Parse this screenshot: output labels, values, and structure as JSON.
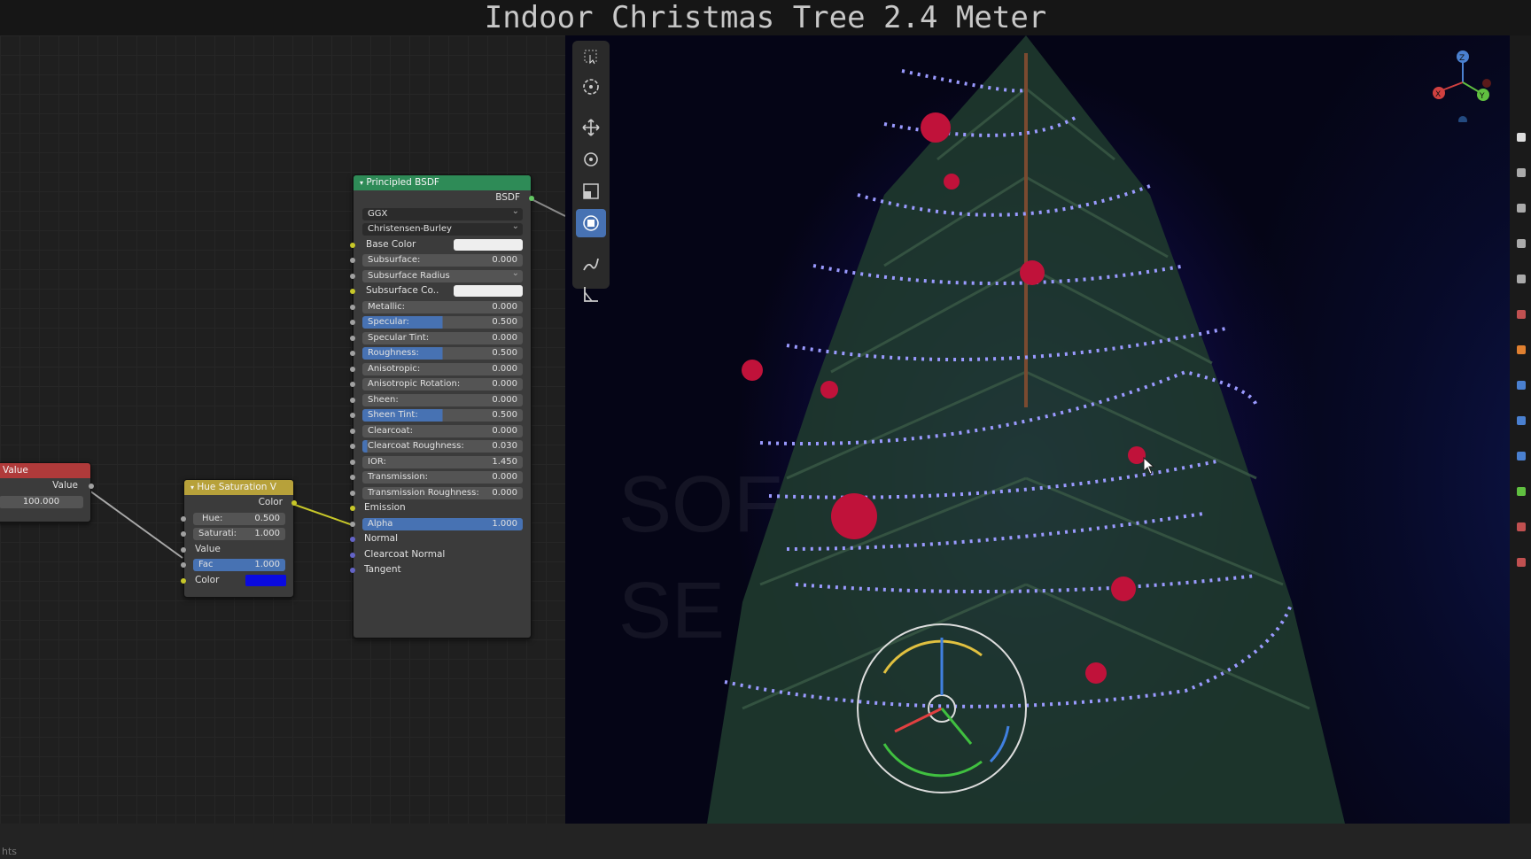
{
  "title": "Indoor Christmas Tree 2.4 Meter",
  "status_text": "hts",
  "value_node": {
    "header": "Value",
    "output_label": "Value",
    "value": "100.000"
  },
  "hue_node": {
    "header": "Hue Saturation V",
    "output_label": "Color",
    "hue_label": "Hue:",
    "hue_value": "0.500",
    "sat_label": "Saturati:",
    "sat_value": "1.000",
    "value_label": "Value",
    "fac_label": "Fac",
    "fac_value": "1.000",
    "color_label": "Color"
  },
  "bsdf_node": {
    "header": "Principled BSDF",
    "output_label": "BSDF",
    "distribution": "GGX",
    "subsurface_method": "Christensen-Burley",
    "fields": [
      {
        "label": "Base Color",
        "kind": "color"
      },
      {
        "label": "Subsurface:",
        "value": "0.000",
        "fill": 0
      },
      {
        "label": "Subsurface Radius",
        "kind": "dropdown"
      },
      {
        "label": "Subsurface Co..",
        "kind": "color"
      },
      {
        "label": "Metallic:",
        "value": "0.000",
        "fill": 0
      },
      {
        "label": "Specular:",
        "value": "0.500",
        "fill": 0.5
      },
      {
        "label": "Specular Tint:",
        "value": "0.000",
        "fill": 0
      },
      {
        "label": "Roughness:",
        "value": "0.500",
        "fill": 0.5
      },
      {
        "label": "Anisotropic:",
        "value": "0.000",
        "fill": 0
      },
      {
        "label": "Anisotropic Rotation:",
        "value": "0.000",
        "fill": 0
      },
      {
        "label": "Sheen:",
        "value": "0.000",
        "fill": 0
      },
      {
        "label": "Sheen Tint:",
        "value": "0.500",
        "fill": 0.5
      },
      {
        "label": "Clearcoat:",
        "value": "0.000",
        "fill": 0
      },
      {
        "label": "Clearcoat Roughness:",
        "value": "0.030",
        "fill": 0.03
      },
      {
        "label": "IOR:",
        "value": "1.450",
        "fill": 0
      },
      {
        "label": "Transmission:",
        "value": "0.000",
        "fill": 0
      },
      {
        "label": "Transmission Roughness:",
        "value": "0.000",
        "fill": 0
      },
      {
        "label": "Emission",
        "kind": "plain"
      },
      {
        "label": "Alpha",
        "value": "1.000",
        "fill": 1
      },
      {
        "label": "Normal",
        "kind": "plain"
      },
      {
        "label": "Clearcoat Normal",
        "kind": "plain"
      },
      {
        "label": "Tangent",
        "kind": "plain"
      }
    ]
  },
  "colors": {
    "value_header": "#b03a3a",
    "hue_header": "#b7a13a",
    "bsdf_header": "#2e8b57",
    "accent": "#4772b3",
    "light_blue": "#7a7aff",
    "emission_color": "#0a0ae0"
  },
  "gizmo_axes": [
    "X",
    "Y",
    "Z"
  ],
  "tools": [
    "select-box-icon",
    "cursor-icon",
    "move-icon",
    "rotate-icon",
    "scale-icon",
    "transform-icon",
    "annotate-icon",
    "measure-icon"
  ]
}
